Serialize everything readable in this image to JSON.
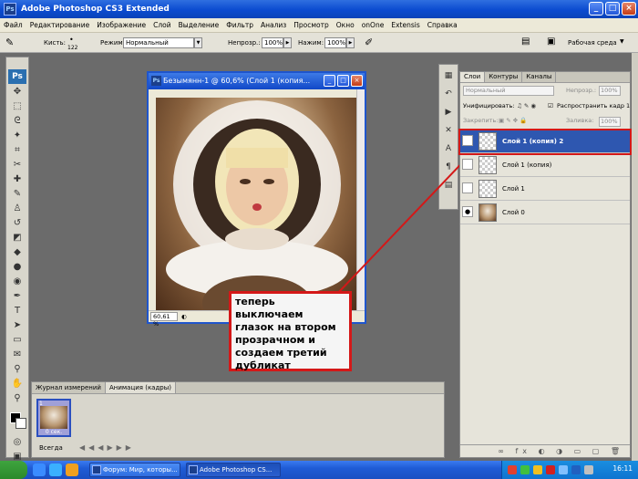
{
  "window": {
    "title": "Adobe Photoshop CS3 Extended",
    "app_icon": "Ps"
  },
  "menu": [
    "Файл",
    "Редактирование",
    "Изображение",
    "Слой",
    "Выделение",
    "Фильтр",
    "Анализ",
    "Просмотр",
    "Окно",
    "onOne",
    "Extensis",
    "Справка"
  ],
  "options": {
    "brush_label": "Кисть:",
    "brush_size": "122",
    "mode_label": "Режим:",
    "mode_value": "Нормальный",
    "opacity_label": "Непрозр.:",
    "opacity_value": "100%",
    "pressure_label": "Нажим:",
    "pressure_value": "100%",
    "workspace_label": "Рабочая среда"
  },
  "toolbox": {
    "logo": "Ps"
  },
  "document": {
    "title": "Безымянн-1 @ 60,6% (Слой 1 (копия...",
    "zoom": "60,61 %"
  },
  "callout": {
    "text": "теперь выключаем глазок на втором прозрачном и создаем третий дубликат"
  },
  "animation": {
    "tabs": [
      "Журнал измерений",
      "Анимация (кадры)"
    ],
    "active_tab": 1,
    "frame_number": "1",
    "frame_time": "0 сек.",
    "loop": "Всегда"
  },
  "layers_panel": {
    "tabs": [
      "Слои",
      "Контуры",
      "Каналы"
    ],
    "blend_mode": "Нормальный",
    "opacity_label": "Непрозр.:",
    "opacity_value": "100%",
    "unify_label": "Унифицировать:",
    "propagate_label": "Распространить кадр 1",
    "lock_label": "Закрепить:",
    "fill_label": "Заливка:",
    "fill_value": "100%",
    "layers": [
      {
        "name": "Слой 1 (копия) 2",
        "selected": true,
        "visible": false,
        "thumb": "transparent"
      },
      {
        "name": "Слой 1 (копия)",
        "selected": false,
        "visible": false,
        "thumb": "transparent"
      },
      {
        "name": "Слой 1",
        "selected": false,
        "visible": false,
        "thumb": "transparent"
      },
      {
        "name": "Слой 0",
        "selected": false,
        "visible": true,
        "thumb": "photo"
      }
    ]
  },
  "taskbar": {
    "items": [
      "Форум: Мир, которы...",
      "Adobe Photoshop CS..."
    ],
    "active_item": 1,
    "clock": "16:11"
  },
  "colors": {
    "accent": "#d41818",
    "selection": "#2e57b0",
    "titlebar": "#0b4bd0"
  }
}
